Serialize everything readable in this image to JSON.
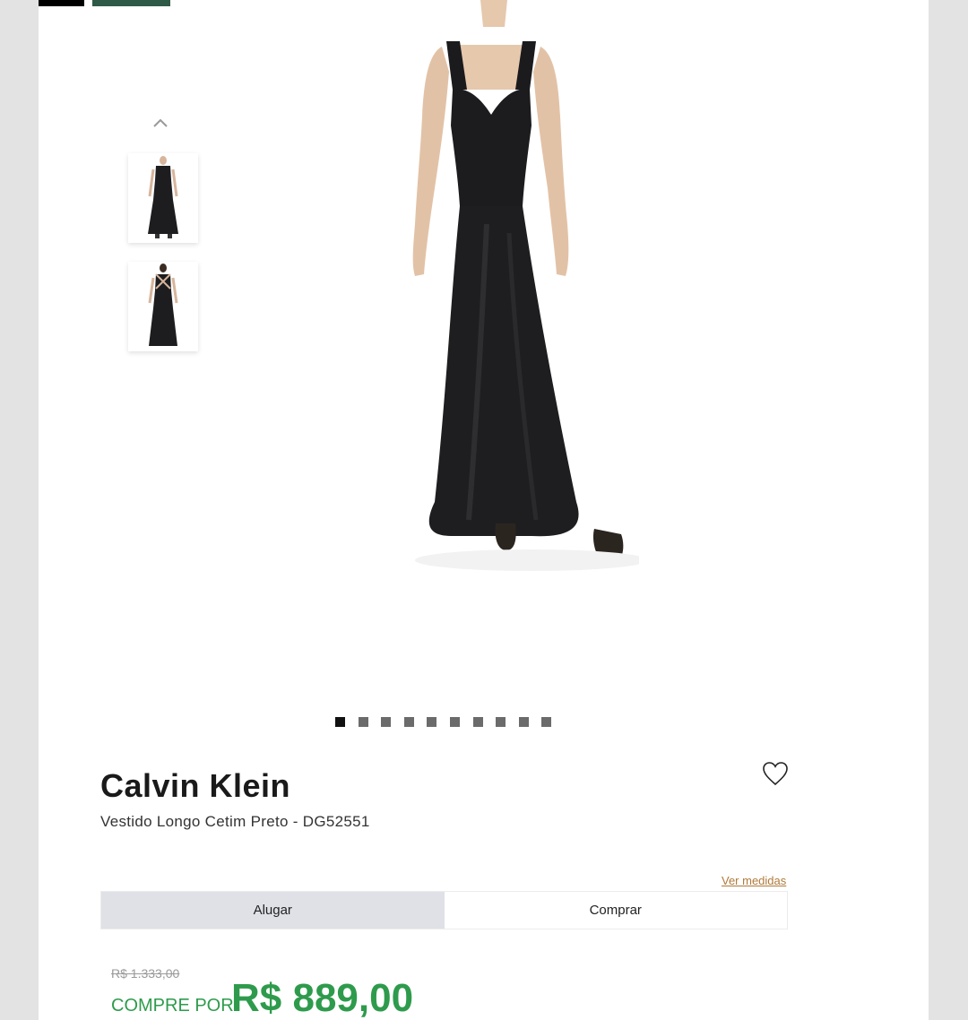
{
  "product": {
    "brand": "Calvin Klein",
    "name": "Vestido Longo Cetim Preto - DG52551",
    "size_link": "Ver medidas"
  },
  "tabs": [
    {
      "label": "Alugar",
      "active": true
    },
    {
      "label": "Comprar",
      "active": false
    }
  ],
  "pricing": {
    "old_price": "R$ 1.333,00",
    "buy_label": "COMPRE POR:",
    "buy_price": "R$ 889,00"
  },
  "carousel": {
    "total_slides": 10,
    "active_index": 0
  },
  "colors": {
    "price_green": "#2e9b4c",
    "active_tab_bg": "#dfe1e7",
    "link_color": "#b07a3a",
    "header_green": "#2f5a47"
  },
  "icons": {
    "thumb_up": "chevron-up-icon",
    "favorite": "heart-outline-icon"
  }
}
